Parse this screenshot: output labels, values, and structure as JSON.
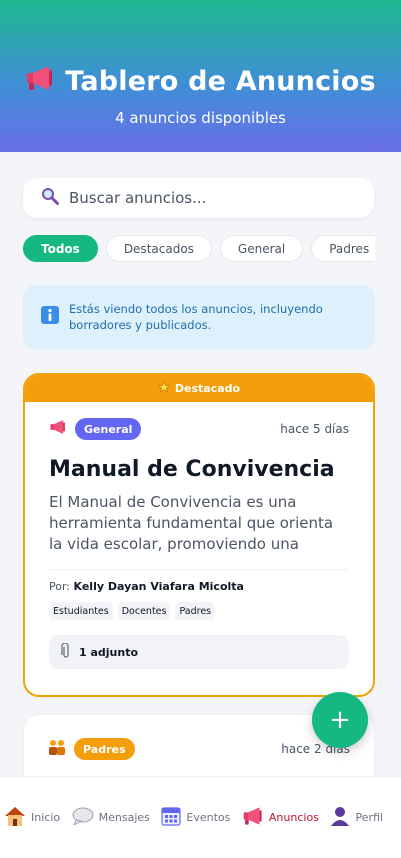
{
  "header": {
    "title": "Tablero de Anuncios",
    "subtitle": "4 anuncios disponibles",
    "icon": "megaphone-icon"
  },
  "search": {
    "placeholder": "Buscar anuncios...",
    "value": "",
    "icon": "magnifier-icon"
  },
  "filters": [
    {
      "label": "Todos",
      "active": true
    },
    {
      "label": "Destacados",
      "active": false
    },
    {
      "label": "General",
      "active": false
    },
    {
      "label": "Padres",
      "active": false
    }
  ],
  "info": {
    "text": "Estás viendo todos los anuncios, incluyendo borradores y publicados.",
    "icon": "info-icon"
  },
  "announcements": [
    {
      "featured_label": "Destacado",
      "category": "General",
      "time": "hace 5 días",
      "title": "Manual de Convivencia",
      "excerpt": "El Manual de Convivencia es una herramienta fundamental que orienta la vida escolar, promoviendo una cultura d...",
      "author_prefix": "Por:",
      "author": "Kelly Dayan Viafara Micolta",
      "tags": [
        "Estudiantes",
        "Docentes",
        "Padres"
      ],
      "attachments": "1 adjunto"
    },
    {
      "category": "Padres",
      "time": "hace 2 días"
    }
  ],
  "fab": {
    "label": "+"
  },
  "nav": [
    {
      "label": "Inicio",
      "icon": "house-icon",
      "active": false
    },
    {
      "label": "Mensajes",
      "icon": "speech-bubble-icon",
      "active": false
    },
    {
      "label": "Eventos",
      "icon": "calendar-icon",
      "active": false
    },
    {
      "label": "Anuncios",
      "icon": "megaphone-icon",
      "active": true
    },
    {
      "label": "Perfil",
      "icon": "user-icon",
      "active": false
    }
  ],
  "colors": {
    "primary": "#16b882",
    "featured": "#f59e0b",
    "general_badge": "#6366f1",
    "active_nav": "#c0152f"
  }
}
